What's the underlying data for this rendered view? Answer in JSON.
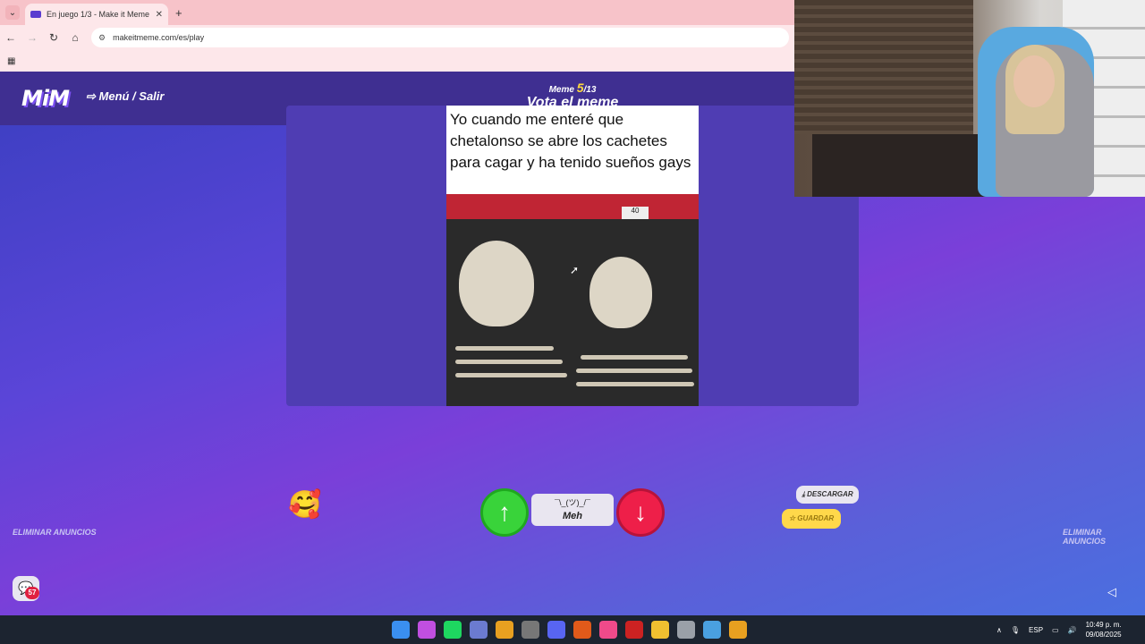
{
  "browser": {
    "tab_title": "En juego 1/3 - Make it Meme",
    "url": "makeitmeme.com/es/play",
    "new_tab_symbol": "+",
    "tab_close_symbol": "✕"
  },
  "game": {
    "logo": "MiM",
    "menu_label": "⇨ Menú / Salir",
    "meme_word": "Meme",
    "meme_current": "5",
    "meme_total": "/13",
    "vote_title": "Vota el meme",
    "meme_caption": "Yo cuando me enteré que chetalonso se abre los cachetes para cagar y ha tenido sueños gays",
    "price_tag": "40",
    "meh_face": "¯\\_(ツ)_/¯",
    "meh_label": "Meh",
    "download_label": "⤓ DESCARGAR",
    "save_label": "☆ GUARDAR",
    "remove_ads_left": "ELIMINAR ANUNCIOS",
    "remove_ads_right": "ELIMINAR ANUNCIOS",
    "chat_badge": "57"
  },
  "taskbar": {
    "language": "ESP",
    "time": "10:49 p. m.",
    "date": "09/08/2025",
    "icon_colors": [
      "#3a8ff0",
      "#c04fe0",
      "#1ed760",
      "#6b7bd0",
      "#e8a020",
      "#777777",
      "#5865f2",
      "#e05a1a",
      "#f04a8a",
      "#cc2222",
      "#f0c030",
      "#9aa0a8",
      "#4aa0e0",
      "#e8a020"
    ]
  },
  "colors": {
    "vote_up": "#39d33a",
    "vote_down": "#ee1f49",
    "progress": "#ffe03a",
    "header": "#3f2f91"
  }
}
